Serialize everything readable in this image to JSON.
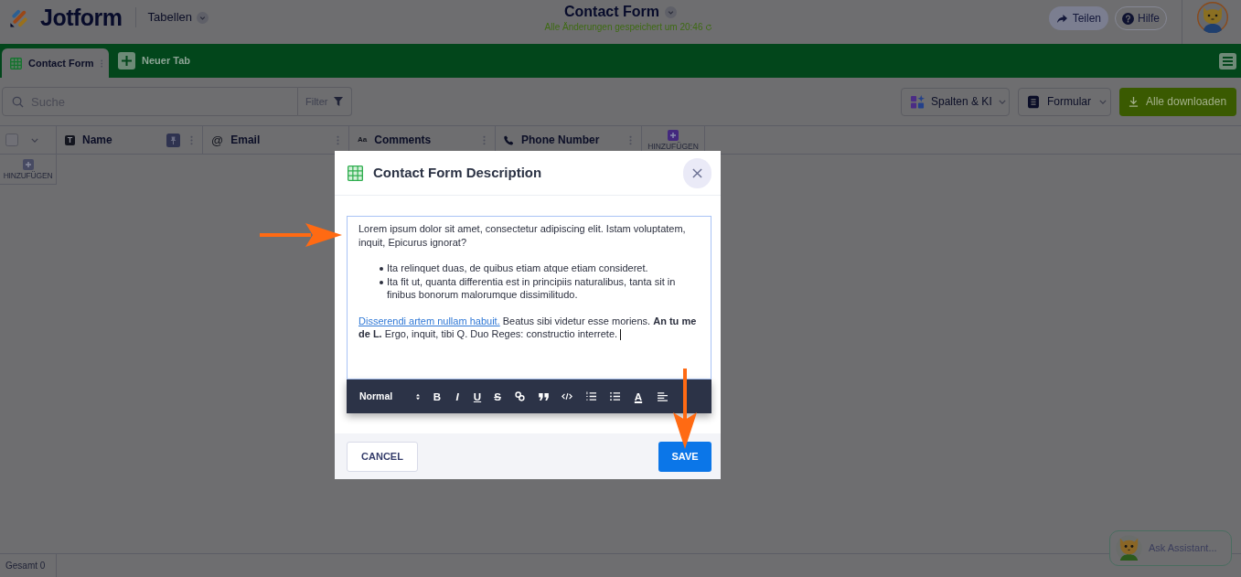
{
  "header": {
    "logo": "Jotform",
    "section": "Tabellen",
    "title": "Contact Form",
    "save_status": "Alle Änderungen gespeichert um 20:46",
    "buttons": [
      {
        "kind": "share",
        "label": "Teilen"
      },
      {
        "kind": "help",
        "label": "Hilfe"
      }
    ]
  },
  "tabs": [
    {
      "label": "Contact Form",
      "selected": true
    }
  ],
  "new_tab": "Neuer Tab",
  "toolbar": {
    "search": {
      "placeholder": "Suche"
    },
    "filter": "Filter",
    "buttons": [
      {
        "kind": "columns",
        "label": "Spalten & KI"
      },
      {
        "kind": "form",
        "label": "Formular"
      },
      {
        "kind": "download",
        "label": "Alle downloaden"
      }
    ]
  },
  "table": {
    "select_all": {
      "checked": false
    },
    "columns": [
      {
        "kind": "text",
        "icon": "T",
        "label": "Name",
        "pinned": true
      },
      {
        "kind": "email",
        "icon": "@",
        "label": "Email",
        "pinned": false
      },
      {
        "kind": "textarea",
        "icon": "Aa",
        "label": "Comments",
        "pinned": false
      },
      {
        "kind": "phone",
        "label": "Phone Number",
        "pinned": false
      }
    ],
    "add_column": "HINZUFÜGEN",
    "add_row": "HINZUFÜGEN"
  },
  "status_bar": {
    "total": "Gesamt 0"
  },
  "assistant": {
    "label": "Ask Assistant..."
  },
  "dialog": {
    "title": "Contact Form Description",
    "editor": {
      "blocks": [
        {
          "kind": "paragraph",
          "text": "Lorem ipsum dolor sit amet, consectetur adipiscing elit. Istam voluptatem, inquit, Epicurus ignorat?"
        },
        {
          "kind": "list",
          "items": [
            "Ita relinquet duas, de quibus etiam atque etiam consideret.",
            "Ita fit ut, quanta differentia est in principiis naturalibus, tanta sit in finibus bonorum malorumque dissimilitudo."
          ]
        },
        {
          "kind": "paragraph",
          "link": "Disserendi artem nullam habuit.",
          "text": "Beatus sibi videtur esse moriens. **An tu me de L.** Ergo, inquit, tibi Q. Duo Reges: constructio interrete."
        }
      ]
    },
    "toolbar": {
      "format": "Normal",
      "tools": [
        {
          "kind": "bold",
          "glyph": "B"
        },
        {
          "kind": "italic",
          "glyph": "I"
        },
        {
          "kind": "underline",
          "glyph": "U"
        },
        {
          "kind": "strike",
          "glyph": "S"
        },
        {
          "kind": "link"
        },
        {
          "kind": "quote"
        },
        {
          "kind": "code"
        },
        {
          "kind": "ordered-list"
        },
        {
          "kind": "bullet-list"
        },
        {
          "kind": "color",
          "glyph": "A"
        },
        {
          "kind": "align"
        }
      ]
    },
    "buttons": [
      {
        "kind": "secondary",
        "label": "CANCEL"
      },
      {
        "kind": "primary",
        "label": "SAVE"
      }
    ]
  },
  "annotations": [
    {
      "kind": "arrow-right"
    },
    {
      "kind": "arrow-down"
    }
  ]
}
